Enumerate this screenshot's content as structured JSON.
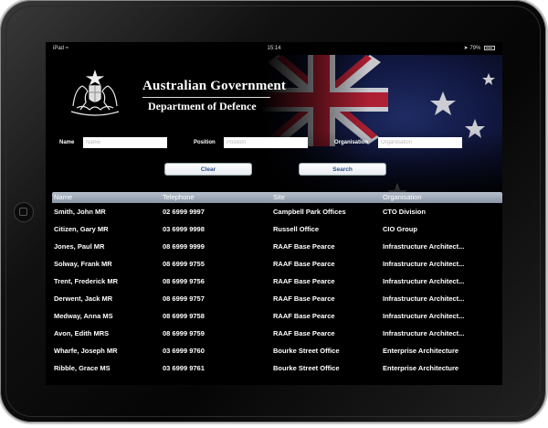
{
  "status_bar": {
    "carrier": "iPad",
    "time": "15:14",
    "battery": "79%"
  },
  "header": {
    "government": "Australian Government",
    "department": "Department of Defence"
  },
  "search": {
    "name_label": "Name",
    "name_placeholder": "Name",
    "position_label": "Position",
    "position_placeholder": "Position",
    "organisation_label": "Organisation",
    "organisation_placeholder": "Organisation",
    "clear_label": "Clear",
    "search_label": "Search"
  },
  "table": {
    "columns": [
      "Name",
      "Telephone",
      "Site",
      "Organisation"
    ],
    "rows": [
      [
        "Smith, John MR",
        "02 6999 9997",
        "Campbell Park Offices",
        "CTO Division"
      ],
      [
        "Citizen, Gary MR",
        "03 6999 9998",
        "Russell Office",
        "CIO Group"
      ],
      [
        "Jones, Paul MR",
        "08 6999 9999",
        "RAAF Base Pearce",
        "Infrastructure Architect..."
      ],
      [
        "Solway, Frank MR",
        "08 6999 9755",
        "RAAF Base Pearce",
        "Infrastructure Architect..."
      ],
      [
        "Trent, Frederick MR",
        "08 6999 9756",
        "RAAF Base Pearce",
        "Infrastructure Architect..."
      ],
      [
        "Derwent, Jack MR",
        "08 6999 9757",
        "RAAF Base Pearce",
        "Infrastructure Architect..."
      ],
      [
        "Medway, Anna MS",
        "08 6999 9758",
        "RAAF Base Pearce",
        "Infrastructure Architect..."
      ],
      [
        "Avon, Edith MRS",
        "08 6999 9759",
        "RAAF Base Pearce",
        "Infrastructure Architect..."
      ],
      [
        "Wharfe, Joseph MR",
        "03 6999 9760",
        "Bourke Street Office",
        "Enterprise Architecture"
      ],
      [
        "Ribble, Grace MS",
        "03 6999 9761",
        "Bourke Street Office",
        "Enterprise Architecture"
      ]
    ]
  },
  "colors": {
    "screen_bg": "#000000",
    "header_bar": "#9aa4b3",
    "button_text": "#2a4f8a"
  },
  "icons": [
    "wifi-icon",
    "location-arrow-icon",
    "battery-icon",
    "coat-of-arms-icon",
    "home-button-icon"
  ]
}
